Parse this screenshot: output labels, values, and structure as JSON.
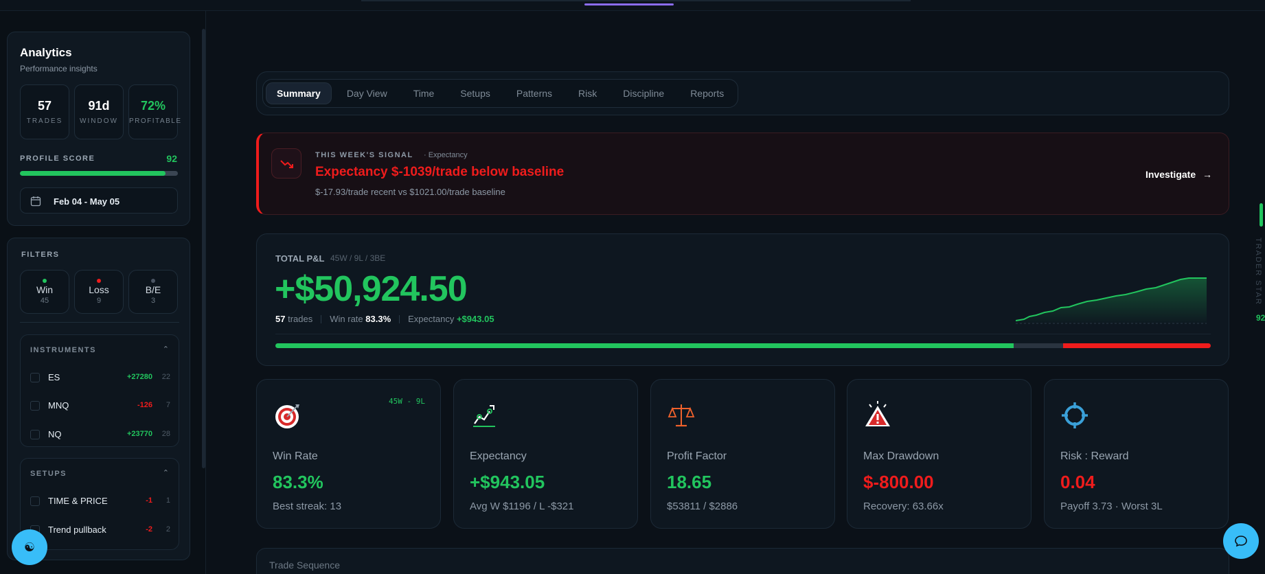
{
  "sidebar": {
    "title": "Analytics",
    "subtitle": "Performance insights",
    "stats": [
      {
        "value": "57",
        "label": "TRADES"
      },
      {
        "value": "91d",
        "label": "WINDOW"
      },
      {
        "value": "72%",
        "label": "PROFITABLE"
      }
    ],
    "profile_score": {
      "label": "PROFILE SCORE",
      "value": "92",
      "fill_percent": 92
    },
    "date_range": "Feb 04 - May 05",
    "filters": {
      "heading": "FILTERS",
      "chips": [
        {
          "name": "Win",
          "count": "45",
          "color": "#22c55e"
        },
        {
          "name": "Loss",
          "count": "9",
          "color": "#ef1c1c"
        },
        {
          "name": "B/E",
          "count": "3",
          "color": "#4b5563"
        }
      ],
      "instruments": {
        "heading": "INSTRUMENTS",
        "items": [
          {
            "name": "ES",
            "pnl": "+27280",
            "count": "22",
            "positive": true
          },
          {
            "name": "MNQ",
            "pnl": "-126",
            "count": "7",
            "positive": false
          },
          {
            "name": "NQ",
            "pnl": "+23770",
            "count": "28",
            "positive": true
          }
        ]
      },
      "setups": {
        "heading": "SETUPS",
        "items": [
          {
            "name": "TIME & PRICE",
            "pnl": "-1",
            "count": "1",
            "positive": false
          },
          {
            "name": "Trend pullback",
            "pnl": "-2",
            "count": "2",
            "positive": false
          }
        ]
      }
    }
  },
  "tabs": [
    "Summary",
    "Day View",
    "Time",
    "Setups",
    "Patterns",
    "Risk",
    "Discipline",
    "Reports"
  ],
  "signal": {
    "kicker": "THIS WEEK'S SIGNAL",
    "kicker_tag": "· Expectancy",
    "title": "Expectancy $-1039/trade below baseline",
    "detail": "$-17.93/trade recent vs $1021.00/trade baseline",
    "action": "Investigate"
  },
  "pnl": {
    "label": "TOTAL P&L",
    "record": "45W / 9L / 3BE",
    "value": "+$50,924.50",
    "trades_count": "57",
    "trades_label": "trades",
    "winrate_label": "Win rate",
    "winrate_value": "83.3%",
    "expectancy_label": "Expectancy",
    "expectancy_value": "+$943.05",
    "split": {
      "win": 45,
      "be": 3,
      "loss": 9
    }
  },
  "metrics": [
    {
      "icon": "target-icon",
      "tag": "45W - 9L",
      "name": "Win Rate",
      "value": "83.3%",
      "sub": "Best streak: 13",
      "color": "#22c55e"
    },
    {
      "icon": "trend-tools-icon",
      "tag": "",
      "name": "Expectancy",
      "value": "+$943.05",
      "sub": "Avg W $1196 / L -$321",
      "color": "#22c55e"
    },
    {
      "icon": "scale-icon",
      "tag": "",
      "name": "Profit Factor",
      "value": "18.65",
      "sub": "$53811 / $2886",
      "color": "#22c55e"
    },
    {
      "icon": "warning-icon",
      "tag": "",
      "name": "Max Drawdown",
      "value": "$-800.00",
      "sub": "Recovery: 63.66x",
      "color": "#ef1c1c"
    },
    {
      "icon": "crosshair-icon",
      "tag": "",
      "name": "Risk : Reward",
      "value": "0.04",
      "sub": "Payoff 3.73 · Worst 3L",
      "color": "#ef1c1c"
    }
  ],
  "trade_sequence": "Trade Sequence",
  "rail": {
    "label": "TRADER STAR",
    "value": "92"
  }
}
